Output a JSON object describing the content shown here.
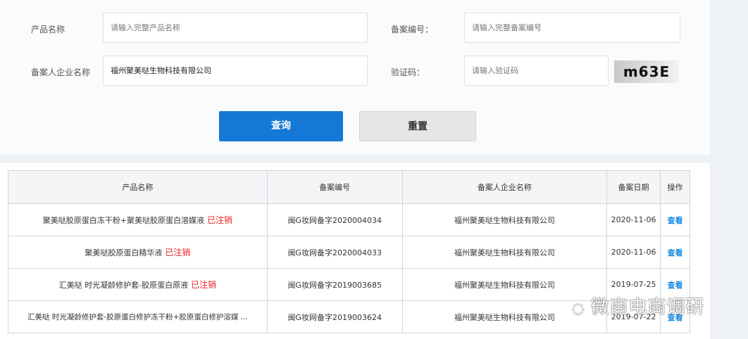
{
  "form": {
    "product_name_label": "产品名称",
    "product_name_placeholder": "请输入完整产品名称",
    "reg_no_label": "备案编号：",
    "reg_no_placeholder": "请输入完整备案编号",
    "company_label": "备案人企业名称",
    "company_value": "福州聚美哒生物科技有限公司",
    "captcha_label": "验证码：",
    "captcha_placeholder": "请输入验证码",
    "captcha_text": "m63E",
    "query_button": "查询",
    "reset_button": "重置"
  },
  "table": {
    "headers": [
      "产品名称",
      "备案编号",
      "备案人企业名称",
      "备案日期",
      "操作"
    ],
    "rows": [
      {
        "name": "聚美哒胶原蛋白冻干粉+聚美哒胶原蛋白溶媒液",
        "status": "已注销",
        "reg": "闽G妆网备字2020004034",
        "company": "福州聚美哒生物科技有限公司",
        "date": "2020-11-06",
        "action": "查看"
      },
      {
        "name": "聚美哒胶原蛋白精华液",
        "status": "已注销",
        "reg": "闽G妆网备字2020004033",
        "company": "福州聚美哒生物科技有限公司",
        "date": "2020-11-06",
        "action": "查看"
      },
      {
        "name": "汇美哒 时光凝龄修护套-胶原蛋白原液",
        "status": "已注销",
        "reg": "闽G妆网备字2019003685",
        "company": "福州聚美哒生物科技有限公司",
        "date": "2019-07-25",
        "action": "查看"
      },
      {
        "name": "汇美哒 时光凝龄修护套-胶原蛋白修护冻干粉+胶原蛋白修护溶媒 ...",
        "status": "",
        "reg": "闽G妆网备字2019003624",
        "company": "福州聚美哒生物科技有限公司",
        "date": "2019-07-22",
        "action": "查看"
      }
    ]
  },
  "watermark": "微商电商调研"
}
